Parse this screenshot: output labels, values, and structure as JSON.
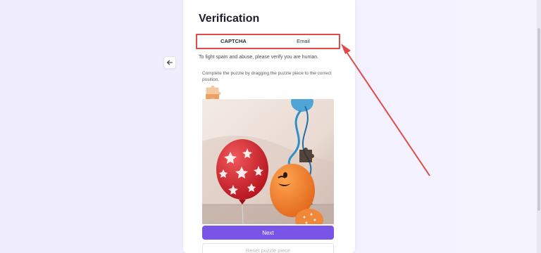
{
  "card": {
    "title": "Verification",
    "tabs": [
      {
        "label": "CAPTCHA",
        "active": true
      },
      {
        "label": "Email",
        "active": false
      }
    ],
    "intro_text": "To fight spam and abuse, please verify you are human.",
    "instruction_text": "Complete the puzzle by dragging the puzzle piece to the correct position.",
    "next_label": "Next",
    "reset_label": "Reset puzzle piece"
  },
  "colors": {
    "accent": "#7a54e6",
    "annotation": "#e04a4a"
  },
  "icons": {
    "back": "arrow-left-icon"
  }
}
